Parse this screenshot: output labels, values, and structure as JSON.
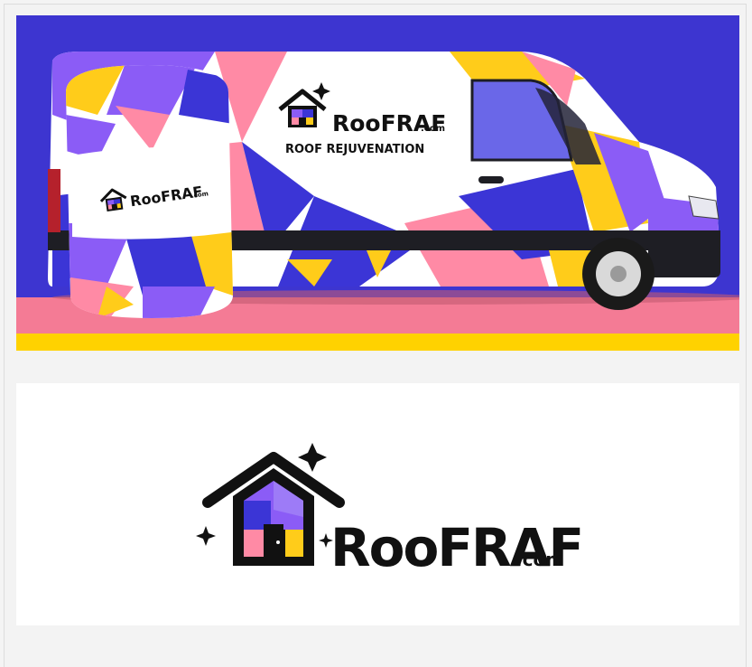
{
  "van": {
    "brand_name": "RooFRAF",
    "brand_suffix": ".com",
    "tagline": "ROOF REJUVENATION"
  },
  "barrel": {
    "brand_name": "RooFRAF",
    "brand_suffix": ".com"
  },
  "logo": {
    "brand_name": "RooFRAF",
    "brand_suffix": ".com"
  },
  "colors": {
    "background_purple": "#3d35d0",
    "floor_pink": "#f47b95",
    "floor_yellow": "#ffd200",
    "accent_purple": "#8b5cf6",
    "accent_blue": "#3b35d6",
    "accent_pink": "#ff8aa5",
    "accent_yellow": "#ffcc1a",
    "ink": "#111111"
  }
}
